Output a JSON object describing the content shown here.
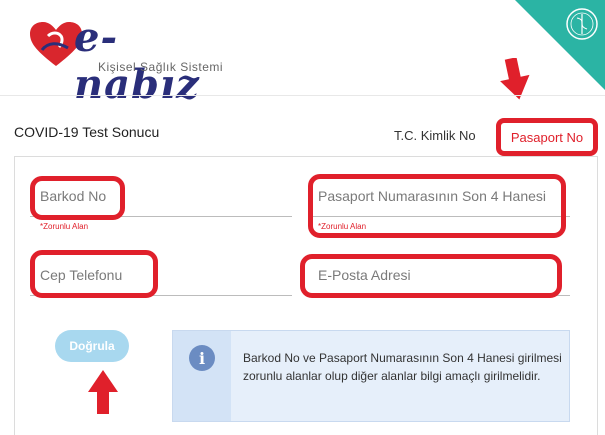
{
  "brand": {
    "name": "e-nabız",
    "subtitle": "Kişisel Sağlık Sistemi"
  },
  "page": {
    "title": "COVID-19 Test Sonucu"
  },
  "tabs": [
    {
      "label": "T.C. Kimlik No",
      "active": false
    },
    {
      "label": "Pasaport No",
      "active": true
    }
  ],
  "form": {
    "barcode": {
      "placeholder": "Barkod No",
      "required_note": "*Zorunlu Alan"
    },
    "passport_last4": {
      "placeholder": "Pasaport Numarasının Son 4 Hanesi",
      "required_note": "*Zorunlu Alan"
    },
    "phone": {
      "placeholder": "Cep Telefonu"
    },
    "email": {
      "placeholder": "E-Posta Adresi"
    },
    "verify_label": "Doğrula"
  },
  "info": {
    "text": "Barkod No ve Pasaport Numarasının Son 4 Hanesi girilmesi zorunlu alanlar olup diğer alanlar bilgi amaçlı girilmelidir."
  },
  "colors": {
    "annotation": "#e0202b",
    "brand": "#2a2e7a",
    "teal": "#2bb4a4",
    "button": "#a8d8ef"
  }
}
